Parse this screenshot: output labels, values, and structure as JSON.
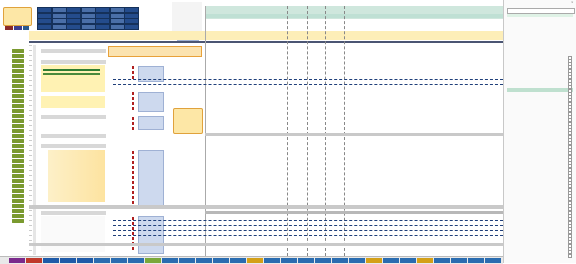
{
  "toolbar": {
    "grid_buttons": [
      "",
      "",
      "",
      "",
      "",
      "",
      "",
      "",
      "",
      "",
      "",
      "",
      "",
      "",
      "",
      "",
      "",
      "",
      "",
      "",
      "",
      "",
      "",
      "",
      "",
      "",
      "",
      ""
    ],
    "left_note": "",
    "small_buttons": [
      "",
      "",
      ""
    ],
    "status_text": "",
    "right_note": ""
  },
  "sheet": {
    "title": "",
    "note_top": "",
    "note_mid": "",
    "side_buttons": [
      "",
      "",
      "",
      "",
      "",
      "",
      "",
      "",
      "",
      "",
      "",
      "",
      "",
      "",
      "",
      "",
      "",
      "",
      "",
      "",
      "",
      "",
      "",
      "",
      "",
      "",
      "",
      "",
      "",
      "",
      "",
      "",
      "",
      "",
      ""
    ],
    "sections": [
      {
        "label": ""
      },
      {
        "label": ""
      },
      {
        "label": ""
      },
      {
        "label": ""
      },
      {
        "label": ""
      },
      {
        "label": ""
      }
    ]
  },
  "tabs": {
    "colors": [
      "#7b2a8c",
      "#c0392b",
      "#1e5aa8",
      "#1e5aa8",
      "#1e5aa8",
      "#2a6cb0",
      "#2a6cb0",
      "#2a6cb0",
      "#7aa83a",
      "#2a6cb0",
      "#2a6cb0",
      "#2a6cb0",
      "#2a6cb0",
      "#2a6cb0",
      "#d4a017",
      "#2a6cb0",
      "#2a6cb0",
      "#2a6cb0",
      "#2a6cb0",
      "#2a6cb0",
      "#2a6cb0",
      "#d4a017",
      "#2a6cb0",
      "#2a6cb0",
      "#d4a017",
      "#2a6cb0",
      "#2a6cb0",
      "#2a6cb0",
      "#2a6cb0"
    ]
  },
  "right_panel": {
    "title": "",
    "header_label": "",
    "items": [
      "",
      "",
      "",
      "",
      "",
      "",
      "",
      "",
      "",
      "",
      "",
      "",
      "",
      "",
      "",
      "",
      "",
      "",
      "",
      "",
      "",
      "",
      "",
      "",
      "",
      "",
      "",
      "",
      "",
      "",
      "",
      "",
      "",
      "",
      "",
      "",
      "",
      "",
      "",
      "",
      "",
      "",
      "",
      "",
      "",
      "",
      "",
      "",
      "",
      "",
      "",
      "",
      "",
      "",
      "",
      "",
      "",
      "",
      "",
      "",
      ""
    ],
    "footer": ""
  }
}
